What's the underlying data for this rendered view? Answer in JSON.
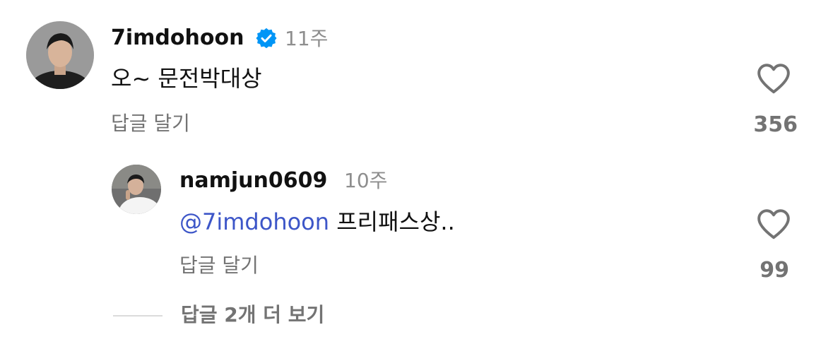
{
  "comment": {
    "username": "7imdohoon",
    "verified": true,
    "timestamp": "11주",
    "text": "오~ 문전박대상",
    "reply_label": "답글 달기",
    "like_count": "356"
  },
  "reply": {
    "username": "namjun0609",
    "timestamp": "10주",
    "mention": "@7imdohoon",
    "text": " 프리패스상..",
    "reply_label": "답글 달기",
    "like_count": "99"
  },
  "view_more_label": "답글 2개 더 보기",
  "colors": {
    "verified_badge": "#0095f6",
    "mention": "#3d56c8",
    "secondary_text": "#737373",
    "timestamp": "#8e8e8e"
  }
}
